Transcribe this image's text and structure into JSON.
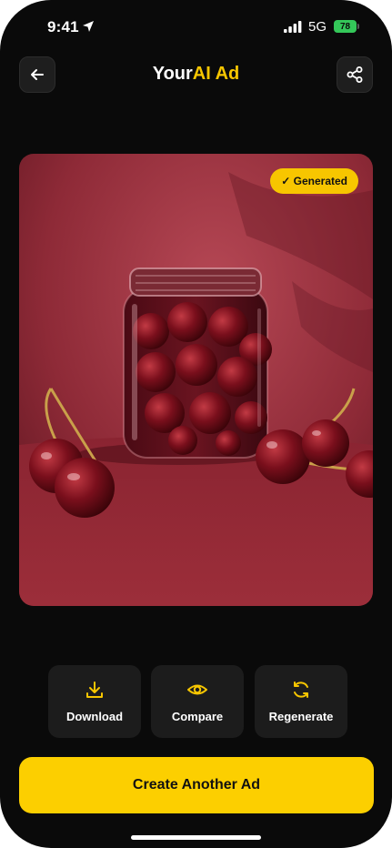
{
  "status_bar": {
    "time": "9:41",
    "network": "5G",
    "battery": "78"
  },
  "header": {
    "title_part1": "Your",
    "title_part2": "AI Ad",
    "back_icon": "arrow-left-icon",
    "share_icon": "share-icon"
  },
  "ad_image": {
    "description_icon": "cherries-jar-image",
    "badge": "✓ Generated"
  },
  "actions": [
    {
      "label": "Download",
      "icon": "download-icon"
    },
    {
      "label": "Compare",
      "icon": "eye-icon"
    },
    {
      "label": "Regenerate",
      "icon": "refresh-icon"
    }
  ],
  "cta": {
    "label": "Create Another Ad"
  },
  "colors": {
    "accent": "#f7c600",
    "background": "#0a0a0a",
    "card": "#1c1c1c"
  }
}
